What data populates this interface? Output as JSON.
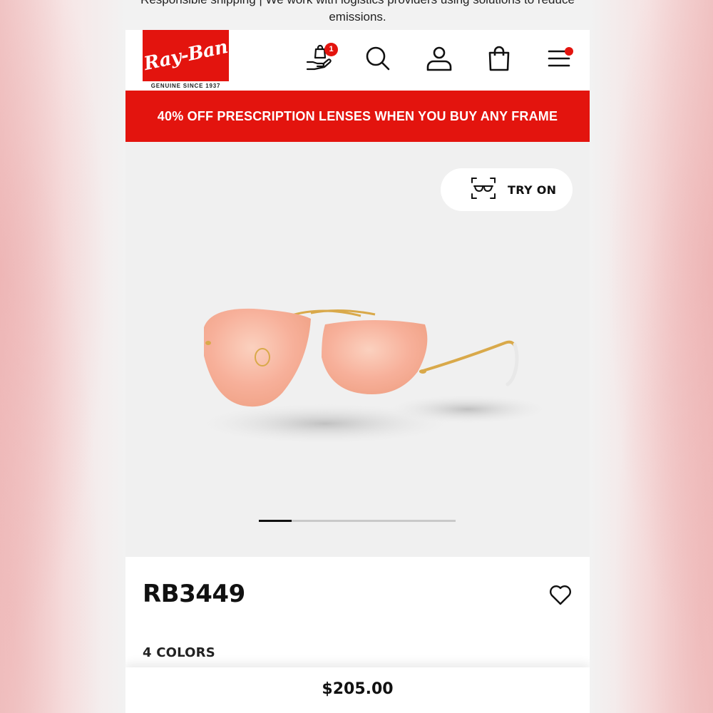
{
  "top_banner": {
    "text": "Responsible shipping | We work with logistics providers using solutions to reduce emissions."
  },
  "header": {
    "logo_text": "Ray-Ban",
    "logo_tagline": "GENUINE SINCE 1937",
    "icons": {
      "wishlist": "hand-bag-icon",
      "search": "search-icon",
      "account": "user-icon",
      "cart": "shopping-bag-icon",
      "menu": "hamburger-menu-icon"
    },
    "wishlist_badge": "1"
  },
  "promo": {
    "text": "40% OFF PRESCRIPTION LENSES WHEN YOU BUY ANY FRAME"
  },
  "gallery": {
    "try_on_label": "TRY ON",
    "try_on_icon": "glasses-scan-icon",
    "slides_total": 6,
    "active_slide": 1
  },
  "product": {
    "model": "RB3449",
    "colors_label": "4 COLORS",
    "price": "$205.00",
    "favorite_icon": "heart-icon"
  },
  "colors": {
    "brand_red": "#e3140e",
    "lens": "#f7b49a",
    "frame_gold": "#d9a94a"
  }
}
